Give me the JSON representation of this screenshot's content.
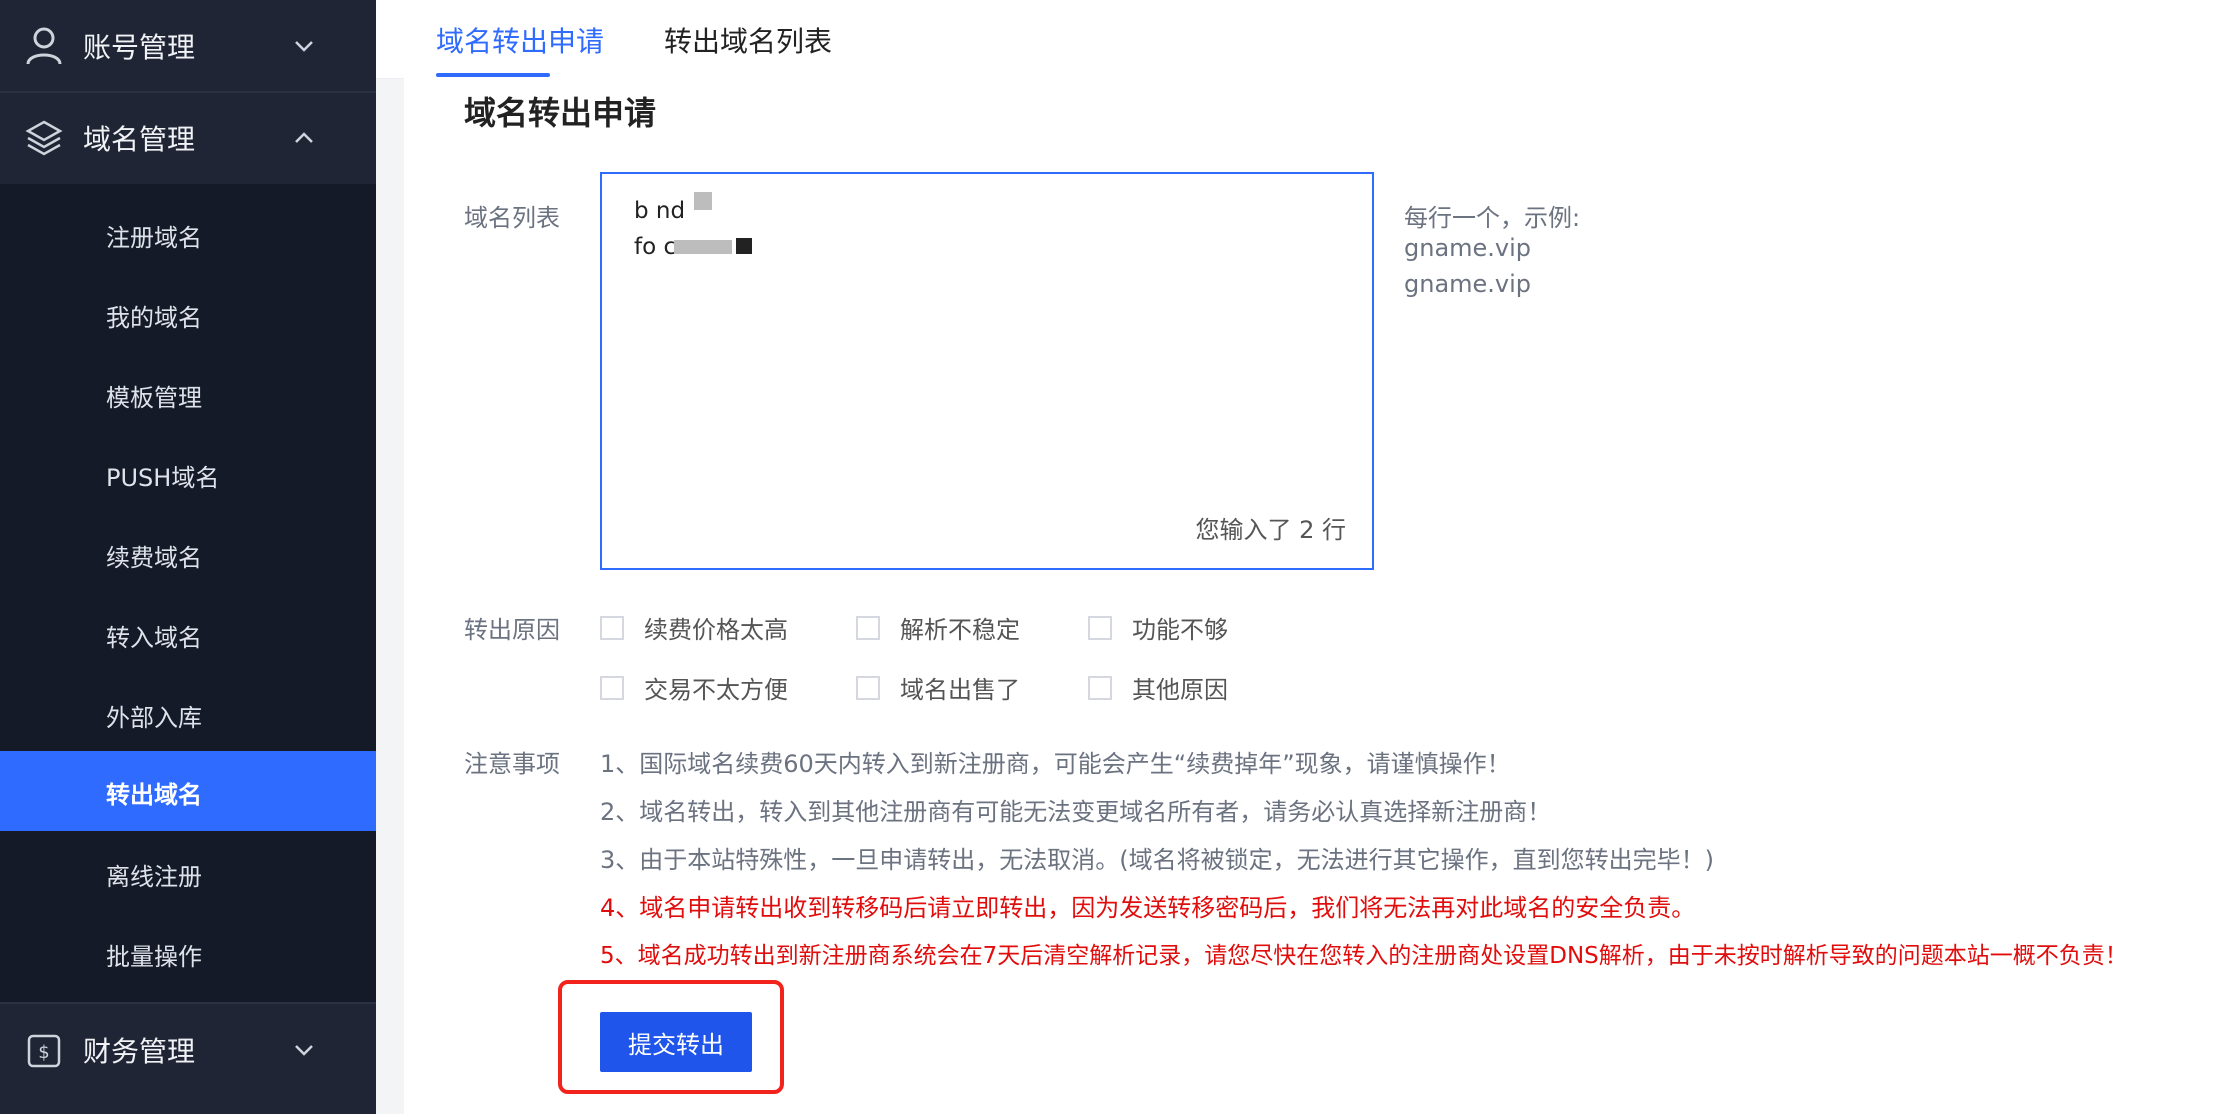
{
  "sidebar": {
    "groups": [
      {
        "label": "账号管理",
        "icon": "user-icon",
        "state": "collapsed"
      },
      {
        "label": "域名管理",
        "icon": "layers-icon",
        "state": "expanded"
      },
      {
        "label": "财务管理",
        "icon": "finance-icon",
        "state": "collapsed"
      }
    ],
    "items": [
      {
        "label": "注册域名"
      },
      {
        "label": "我的域名"
      },
      {
        "label": "模板管理"
      },
      {
        "label": "PUSH域名"
      },
      {
        "label": "续费域名"
      },
      {
        "label": "转入域名"
      },
      {
        "label": "外部入库"
      },
      {
        "label": "转出域名",
        "active": true
      },
      {
        "label": "离线注册"
      },
      {
        "label": "批量操作"
      }
    ]
  },
  "tabs": [
    {
      "label": "域名转出申请",
      "active": true
    },
    {
      "label": "转出域名列表"
    }
  ],
  "page": {
    "title": "域名转出申请",
    "domain_list_label": "域名列表",
    "domain_lines": [
      "b          nd",
      "fo          cn"
    ],
    "line_count_text": "您输入了 2 行",
    "example_hint": [
      "每行一个，示例:",
      "gname.vip",
      "gname.vip"
    ],
    "reason_label": "转出原因",
    "reasons": [
      "续费价格太高",
      "解析不稳定",
      "功能不够",
      "交易不太方便",
      "域名出售了",
      "其他原因"
    ],
    "notes_label": "注意事项",
    "notes": [
      {
        "text": "1、国际域名续费60天内转入到新注册商，可能会产生“续费掉年”现象，请谨慎操作！",
        "color": "#6b7280"
      },
      {
        "text": "2、域名转出，转入到其他注册商有可能无法变更域名所有者，请务必认真选择新注册商！",
        "color": "#6b7280"
      },
      {
        "text": "3、由于本站特殊性，一旦申请转出，无法取消。(域名将被锁定，无法进行其它操作，直到您转出完毕！)",
        "color": "#6b7280"
      },
      {
        "text": "4、域名申请转出收到转移码后请立即转出，因为发送转移密码后，我们将无法再对此域名的安全负责。",
        "color": "#e10d0d"
      },
      {
        "text": "5、域名成功转出到新注册商系统会在7天后清空解析记录，请您尽快在您转入的注册商处设置DNS解析，由于未按时解析导致的问题本站一概不负责！",
        "color": "#e10d0d"
      }
    ],
    "submit_label": "提交转出"
  },
  "colors": {
    "accent": "#2f6bff",
    "sidebar_bg": "#1f2535",
    "warning": "#e10d0d",
    "highlight": "#f2231d"
  }
}
